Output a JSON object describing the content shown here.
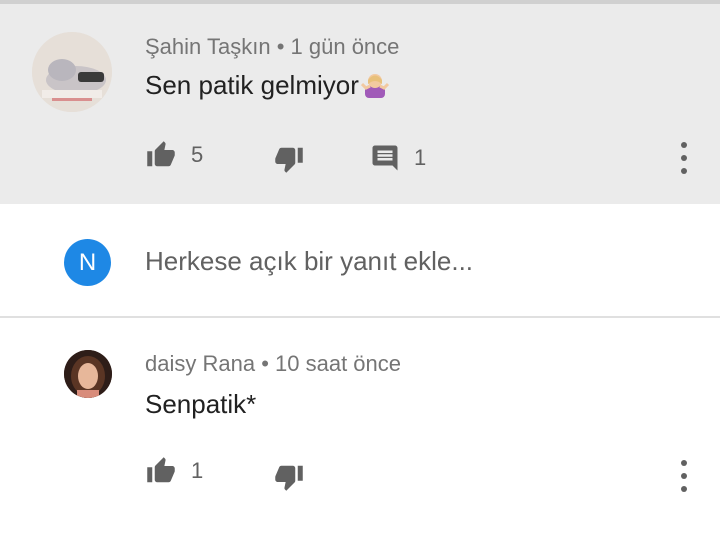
{
  "comments": [
    {
      "author": "Şahin Taşkın",
      "time": "1 gün önce",
      "text": "Sen patik gelmiyor",
      "emoji": "person-shrugging-emoji",
      "likes": "5",
      "replies": "1"
    },
    {
      "author": "daisy Rana",
      "time": "10 saat önce",
      "text": "Senpatik*",
      "likes": "1"
    }
  ],
  "reply_box": {
    "avatar_letter": "N",
    "placeholder": "Herkese açık bir yanıt ekle..."
  },
  "colors": {
    "highlight_bg": "#ebebeb",
    "avatar_blue": "#1e88e5",
    "icon_gray": "#616161"
  },
  "icons": [
    "thumbs-up-icon",
    "thumbs-down-icon",
    "comment-icon",
    "more-vert-icon"
  ]
}
